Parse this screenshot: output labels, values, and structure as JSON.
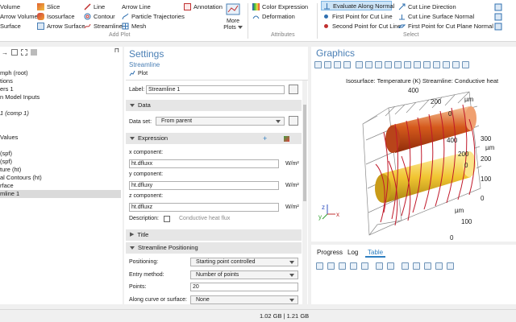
{
  "ribbon": {
    "col1": [
      "Volume",
      "Arrow Volume",
      "Surface"
    ],
    "col2": [
      "Slice",
      "Isosurface",
      "Arrow Surface"
    ],
    "col3": [
      "Line",
      "Contour",
      "Streamline"
    ],
    "col4": [
      "Arrow Line",
      "Particle Trajectories",
      "Mesh"
    ],
    "annotation": "Annotation",
    "more_plots_line1": "More",
    "more_plots_line2": "Plots",
    "add_plot_group": "Add Plot",
    "attr": [
      "Color Expression",
      "Deformation"
    ],
    "attributes_group": "Attributes",
    "select1": [
      "Evaluate Along Normal",
      "First Point for Cut Line",
      "Second Point for Cut Line"
    ],
    "select2": [
      "Cut Line Direction",
      "Cut Line Surface Normal",
      "First Point for Cut Plane Normal"
    ],
    "select_group": "Select",
    "colors": {
      "accent": "#2f7fc1",
      "highlight": "#cce4f7",
      "title": "#3a7fc4"
    }
  },
  "tree": {
    "items": [
      "mph  (root)",
      "tions",
      "ers 1",
      "n Model Inputs",
      "",
      "1  (comp 1)",
      "",
      "",
      "Values",
      "",
      "(spf)",
      "(spf)",
      "ture (ht)",
      "al Contours (ht)",
      "rface",
      "mline 1"
    ],
    "selected_index": 15
  },
  "settings": {
    "title": "Settings",
    "subtitle": "Streamline",
    "plot_label": "Plot",
    "label_caption": "Label:",
    "label_value": "Streamline 1",
    "data_section": "Data",
    "dataset_caption": "Data set:",
    "dataset_value": "From parent",
    "expression_section": "Expression",
    "x_caption": "x component:",
    "x_value": "ht.dfluxx",
    "y_caption": "y component:",
    "y_value": "ht.dfluxy",
    "z_caption": "z component:",
    "z_value": "ht.dfluxz",
    "unit": "W/m²",
    "description_caption": "Description:",
    "description_value": "Conductive heat flux",
    "title_section": "Title",
    "positioning_section": "Streamline Positioning",
    "positioning_caption": "Positioning:",
    "positioning_value": "Starting point controlled",
    "entry_caption": "Entry method:",
    "entry_value": "Number of points",
    "points_caption": "Points:",
    "points_value": "20",
    "along_caption": "Along curve or surface:",
    "along_value": "None"
  },
  "graphics": {
    "title": "Graphics",
    "plot_title": "Isosurface: Temperature (K)  Streamline: Conductive heat",
    "unit_label": "µm",
    "ticks_top": [
      "400",
      "200",
      "0"
    ],
    "ticks_right": [
      "300",
      "200",
      "100",
      "0"
    ],
    "ticks_front": [
      "400",
      "200",
      "0"
    ],
    "ticks_bottom": [
      "100",
      "0"
    ],
    "axes": {
      "x": "x",
      "y": "y",
      "z": "z"
    }
  },
  "bottom_tabs": [
    "Progress",
    "Log",
    "Table"
  ],
  "active_bottom_tab": "Table",
  "status": {
    "memory": "1.02 GB | 1.21 GB"
  }
}
